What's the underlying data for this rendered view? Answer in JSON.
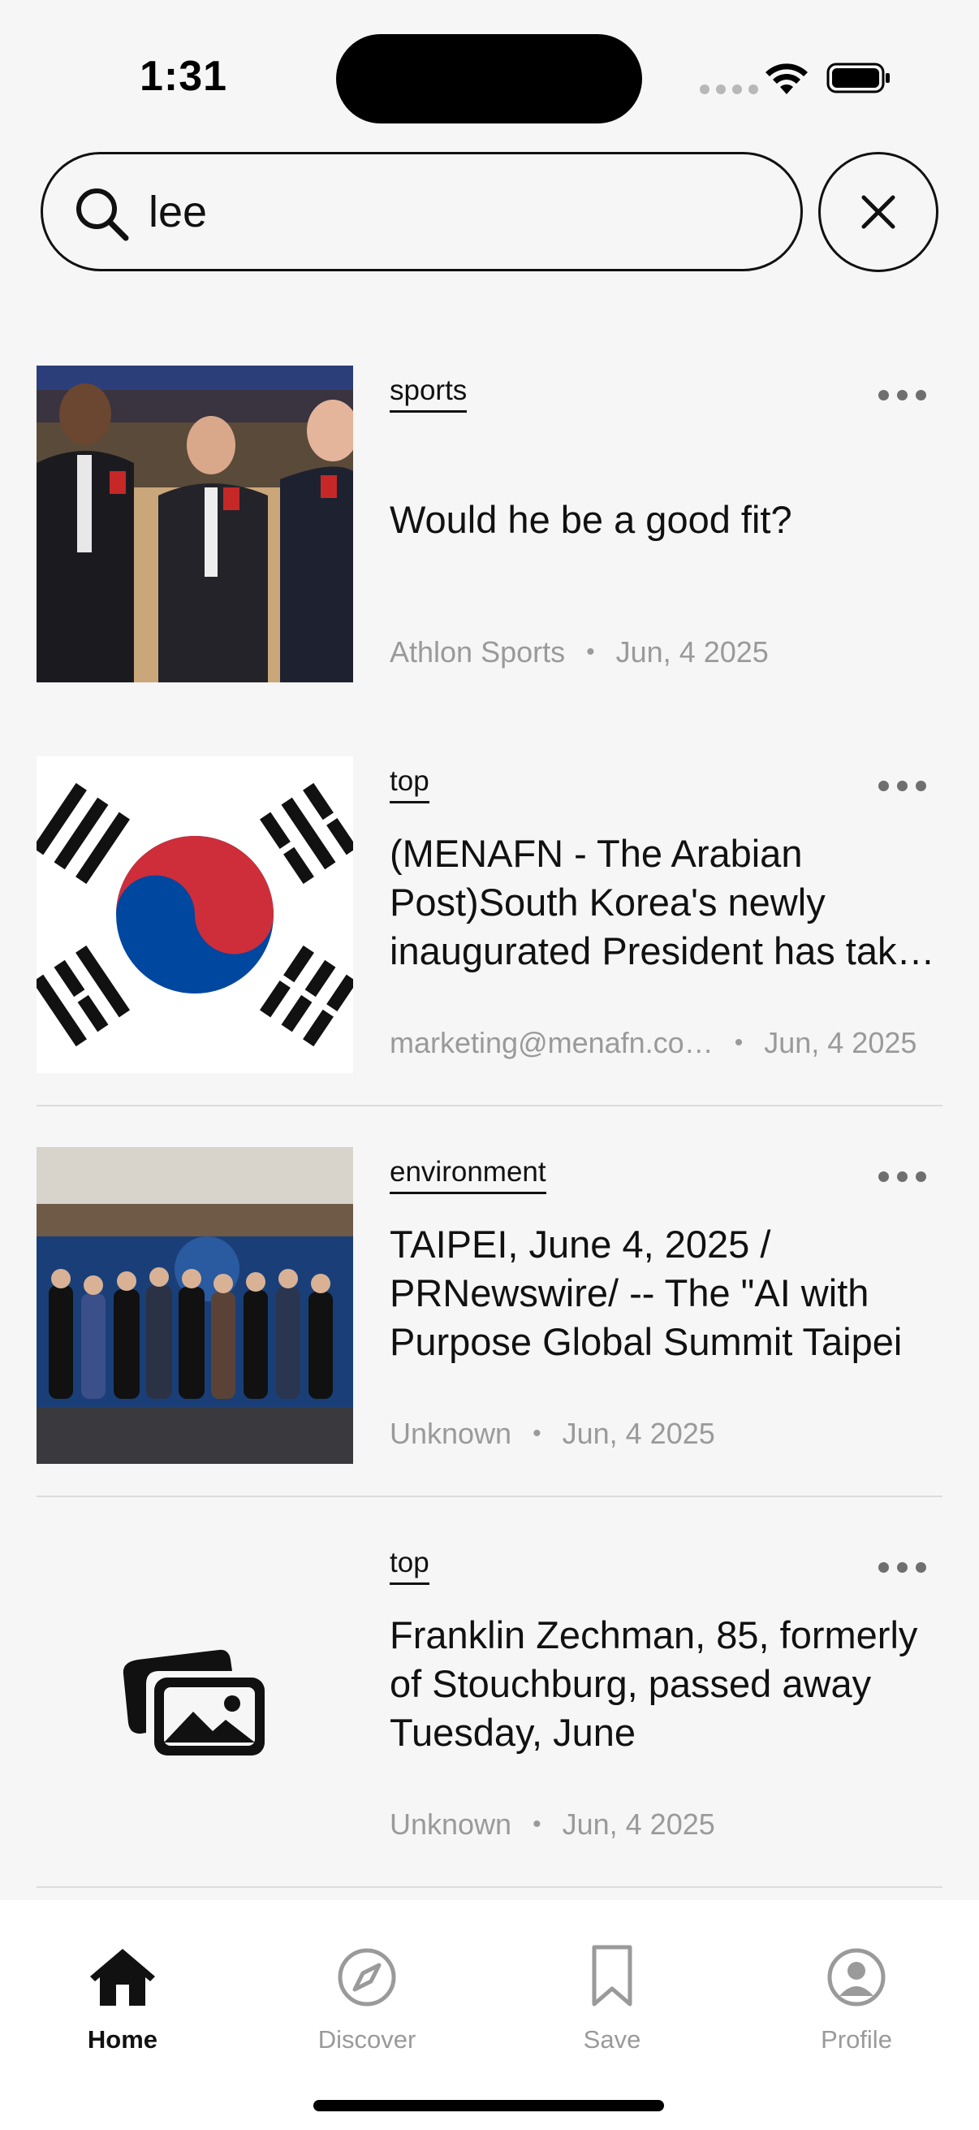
{
  "status_bar": {
    "time": "1:31"
  },
  "search": {
    "value": "lee",
    "placeholder": ""
  },
  "articles": [
    {
      "category": "sports",
      "title": "Would he be a good fit?",
      "source": "Athlon Sports",
      "date": "Jun, 4 2025",
      "image": "photo-sports-broadcasters"
    },
    {
      "category": "top",
      "title": "(MENAFN - The Arabian Post)South Korea's newly inaugurated President has taken office amid",
      "source": "marketing@menafn.co…",
      "date": "Jun, 4 2025",
      "image": "south-korea-flag"
    },
    {
      "category": "environment",
      "title": "TAIPEI, June 4, 2025 / PRNewswire/ -- The \"AI with Purpose Global Summit Taipei",
      "source": "Unknown",
      "date": "Jun, 4 2025",
      "image": "photo-summit-group"
    },
    {
      "category": "top",
      "title": "Franklin Zechman, 85, formerly of Stouchburg, passed away Tuesday, June",
      "source": "Unknown",
      "date": "Jun, 4 2025",
      "image": "image-placeholder-icon"
    }
  ],
  "tabs": [
    {
      "label": "Home",
      "icon": "home-icon",
      "active": true
    },
    {
      "label": "Discover",
      "icon": "compass-icon",
      "active": false
    },
    {
      "label": "Save",
      "icon": "bookmark-icon",
      "active": false
    },
    {
      "label": "Profile",
      "icon": "profile-icon",
      "active": false
    }
  ],
  "colors": {
    "background": "#f6f6f6",
    "text": "#111111",
    "muted": "#9a9a9a",
    "korea_red": "#cd2e3a",
    "korea_blue": "#0047a0"
  }
}
